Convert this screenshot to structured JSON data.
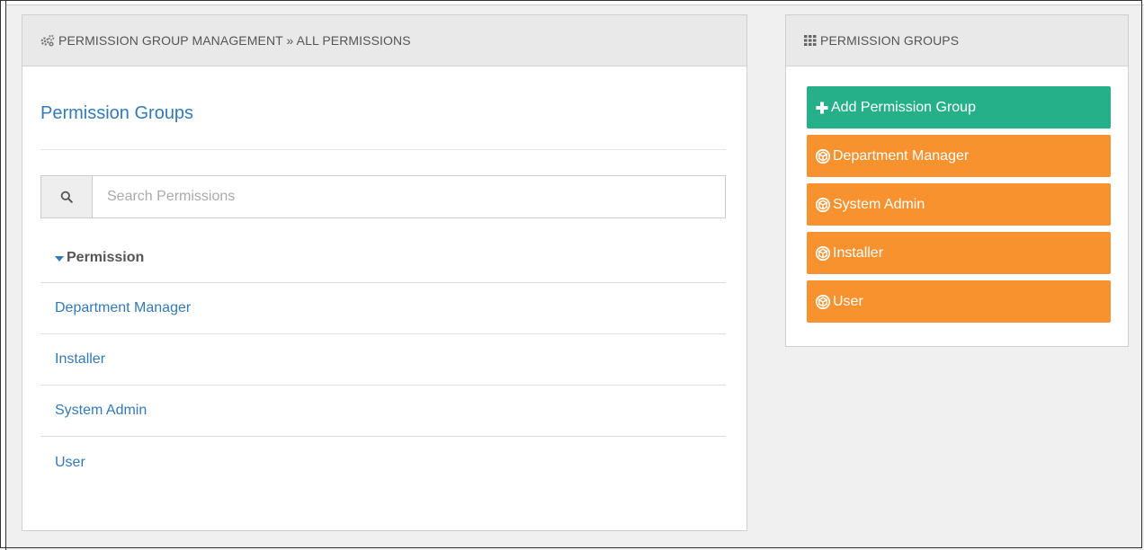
{
  "left_panel": {
    "heading": "PERMISSION GROUP MANAGEMENT » ALL PERMISSIONS",
    "title": "Permission Groups",
    "search": {
      "placeholder": "Search Permissions",
      "value": ""
    },
    "table": {
      "column_header": "Permission",
      "rows": [
        "Department Manager",
        "Installer",
        "System Admin",
        "User"
      ]
    }
  },
  "right_panel": {
    "heading": "PERMISSION GROUPS",
    "add_button_label": "Add Permission Group",
    "groups": [
      "Department Manager",
      "System Admin",
      "Installer",
      "User"
    ]
  },
  "colors": {
    "link": "#337ab7",
    "add_button": "#26b08a",
    "group_button": "#f8922f"
  },
  "icons": {
    "left_heading": "cogs-icon",
    "right_heading": "grid-icon",
    "search": "search-icon",
    "add": "plus-icon",
    "group": "cube-icon",
    "sort": "caret-down-icon"
  }
}
